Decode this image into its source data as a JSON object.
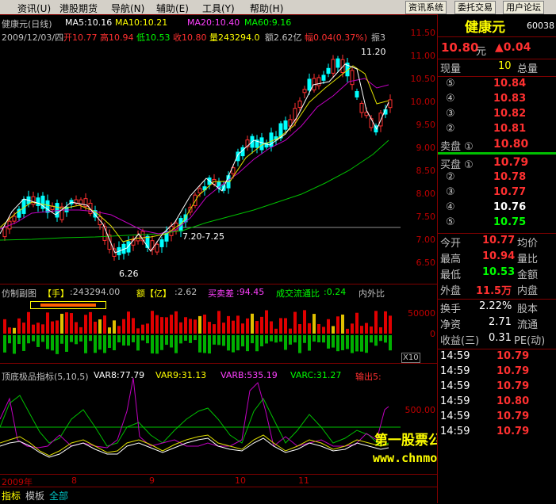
{
  "menu": {
    "items": [
      "资讯(U)",
      "港股期货",
      "导航(N)",
      "辅助(E)",
      "工具(Y)",
      "帮助(H)"
    ],
    "buttons": [
      "资讯系统",
      "委托交易",
      "用户论坛"
    ]
  },
  "main": {
    "title": "健康元(日线)",
    "ma5": "MA5:10.16",
    "ma10": "MA10:10.21",
    "ma20": "MA20:10.40",
    "ma60": "MA60:9.16",
    "date": "2009/12/03/四",
    "open": "开10.77",
    "high": "高10.94",
    "low": "低10.53",
    "close": "收10.80",
    "volume": "量243294.0",
    "amount": "额2.62亿",
    "change": "幅0.04(0.37%)",
    "amplitude": "振3",
    "high_label": "11.20",
    "low_label": "6.26",
    "range_label": "7.20-7.25",
    "price_axis": [
      "11.50",
      "11.00",
      "10.50",
      "10.00",
      "9.50",
      "9.00",
      "8.50",
      "8.00",
      "7.50",
      "7.00",
      "6.50"
    ]
  },
  "vol_panel": {
    "title": "仿制副图",
    "hand_label": "【手】",
    "hand_value": ":243294.00",
    "amt_label": "额【亿】",
    "amt_value": ":2.62",
    "diff_label": "买卖差",
    "diff_value": ":94.45",
    "circ_label": "成交流通比",
    "circ_value": ":0.24",
    "inout_label": "内外比",
    "axis": [
      "50000",
      "0"
    ],
    "scale": "X10"
  },
  "ind_panel": {
    "title": "顶底极品指标(5,10,5)",
    "var8": "VAR8:77.79",
    "var9": "VAR9:31.13",
    "varb": "VARB:535.19",
    "varc": "VARC:31.27",
    "out": "输出5:",
    "axis": [
      "500.00"
    ],
    "watermark1": "第一股票公式网",
    "watermark2": "www.chnmoney.com"
  },
  "time_axis": [
    "2009年",
    "8",
    "9",
    "10",
    "11"
  ],
  "bottom_tabs": [
    "指标",
    "模板",
    "全部"
  ],
  "quote": {
    "name": "健康元",
    "code": "60038",
    "price": "10.80",
    "price_unit": "元",
    "change": "▲0.04",
    "header": {
      "a": "现量",
      "b": "10",
      "c": "总量"
    },
    "sell": [
      {
        "label": "⑤",
        "price": "10.84"
      },
      {
        "label": "④",
        "price": "10.83"
      },
      {
        "label": "③",
        "price": "10.82"
      },
      {
        "label": "②",
        "price": "10.81"
      }
    ],
    "sell1": {
      "label": "卖盘 ①",
      "price": "10.80"
    },
    "buy1": {
      "label": "买盘 ①",
      "price": "10.79"
    },
    "buy": [
      {
        "label": "②",
        "price": "10.78"
      },
      {
        "label": "③",
        "price": "10.77"
      },
      {
        "label": "④",
        "price": "10.76"
      },
      {
        "label": "⑤",
        "price": "10.75"
      }
    ],
    "stats": [
      {
        "l1": "今开",
        "v1": "10.77",
        "l2": "均价"
      },
      {
        "l1": "最高",
        "v1": "10.94",
        "l2": "量比"
      },
      {
        "l1": "最低",
        "v1": "10.53",
        "l2": "金额"
      },
      {
        "l1": "外盘",
        "v1": "11.5万",
        "l2": "内盘"
      }
    ],
    "stats2": [
      {
        "l1": "换手",
        "v1": "2.22%",
        "l2": "股本"
      },
      {
        "l1": "净资",
        "v1": "2.71",
        "l2": "流通"
      },
      {
        "l1": "收益(三)",
        "v1": "0.31",
        "l2": "PE(动)"
      }
    ],
    "ticks": [
      {
        "time": "14:59",
        "price": "10.79"
      },
      {
        "time": "14:59",
        "price": "10.79"
      },
      {
        "time": "14:59",
        "price": "10.79"
      },
      {
        "time": "14:59",
        "price": "10.80"
      },
      {
        "time": "14:59",
        "price": "10.79"
      },
      {
        "time": "14:59",
        "price": "10.79"
      }
    ]
  }
}
